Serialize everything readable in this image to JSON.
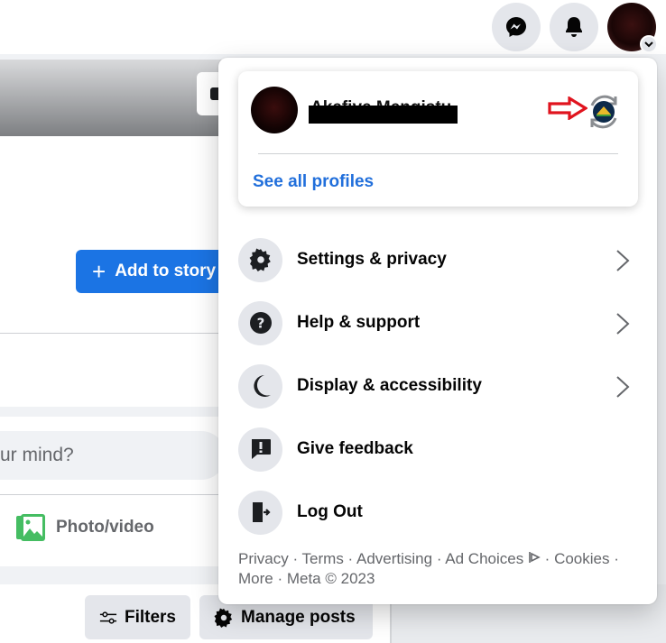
{
  "topbar": {
    "messenger_icon": "messenger-icon",
    "notifications_icon": "bell-icon",
    "account_icon": "avatar",
    "account_chevron": "chevron-down-icon"
  },
  "page": {
    "add_to_story_label": "Add to story",
    "add_to_story_icon": "+",
    "composer_placeholder": "ur mind?",
    "photo_video_label": "Photo/video",
    "filters_label": "Filters",
    "manage_posts_label": "Manage posts"
  },
  "menu": {
    "profile": {
      "name": "Akefiye Mengistu",
      "see_all_profiles": "See all profiles",
      "switch_profile_icon": "switch-profile-icon",
      "annotation_arrow_color": "#e0141e"
    },
    "items": [
      {
        "label": "Settings & privacy",
        "icon": "gear-icon",
        "has_submenu": true
      },
      {
        "label": "Help & support",
        "icon": "question-icon",
        "has_submenu": true
      },
      {
        "label": "Display & accessibility",
        "icon": "moon-icon",
        "has_submenu": true
      },
      {
        "label": "Give feedback",
        "icon": "feedback-icon",
        "has_submenu": false
      },
      {
        "label": "Log Out",
        "icon": "logout-icon",
        "has_submenu": false
      }
    ],
    "footer": {
      "links": [
        "Privacy",
        "Terms",
        "Advertising",
        "Ad Choices",
        "Cookies",
        "More"
      ],
      "copyright": "Meta © 2023",
      "separator": " · "
    }
  },
  "colors": {
    "brand_blue": "#1b74e4",
    "link_blue": "#216fdb",
    "secondary_text": "#65676b",
    "icon_bg": "#e4e6eb"
  }
}
